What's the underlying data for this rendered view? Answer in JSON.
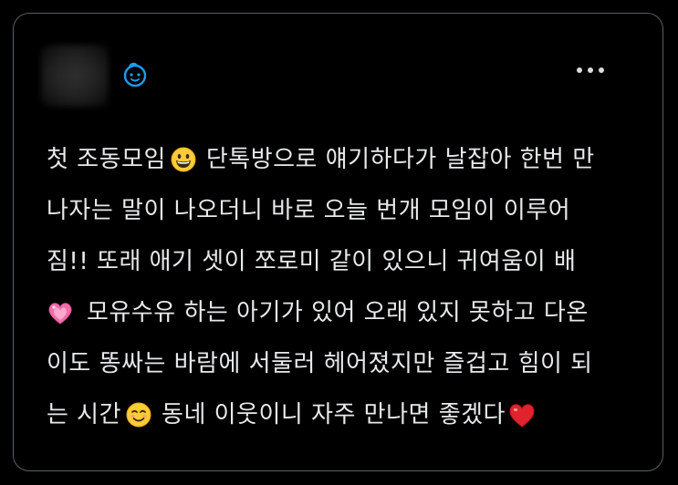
{
  "tweet": {
    "author_icon": "baby-face-icon",
    "more_icon": "more-horizontal-icon",
    "line1": {
      "a": "첫 조동모임",
      "b": "단톡방으로 얘기하다가 날잡아 한번 만"
    },
    "line2": {
      "a": "나자는 말이 나오더니 바로 오늘 번개 모임이 이루어"
    },
    "line3": {
      "a": "짐!! 또래 애기 셋이 쪼로미 같이 있으니 귀여움이 배"
    },
    "line4": {
      "a": "모유수유 하는 아기가 있어 오래 있지 못하고 다온"
    },
    "line5": {
      "a": "이도 똥싸는 바람에 서둘러 헤어졌지만 즐겁고 힘이 되"
    },
    "line6": {
      "a": "는 시간",
      "b": "동네 이웃이니 자주 만나면 좋겠다"
    },
    "emojis": [
      "grinning-face-icon",
      "pink-heart-icon",
      "smiling-face-icon",
      "red-heart-icon"
    ],
    "colors": {
      "text": "#e7e9ea",
      "border": "#5a5f65",
      "icon": "#1d9bf0",
      "background": "#000000"
    }
  }
}
